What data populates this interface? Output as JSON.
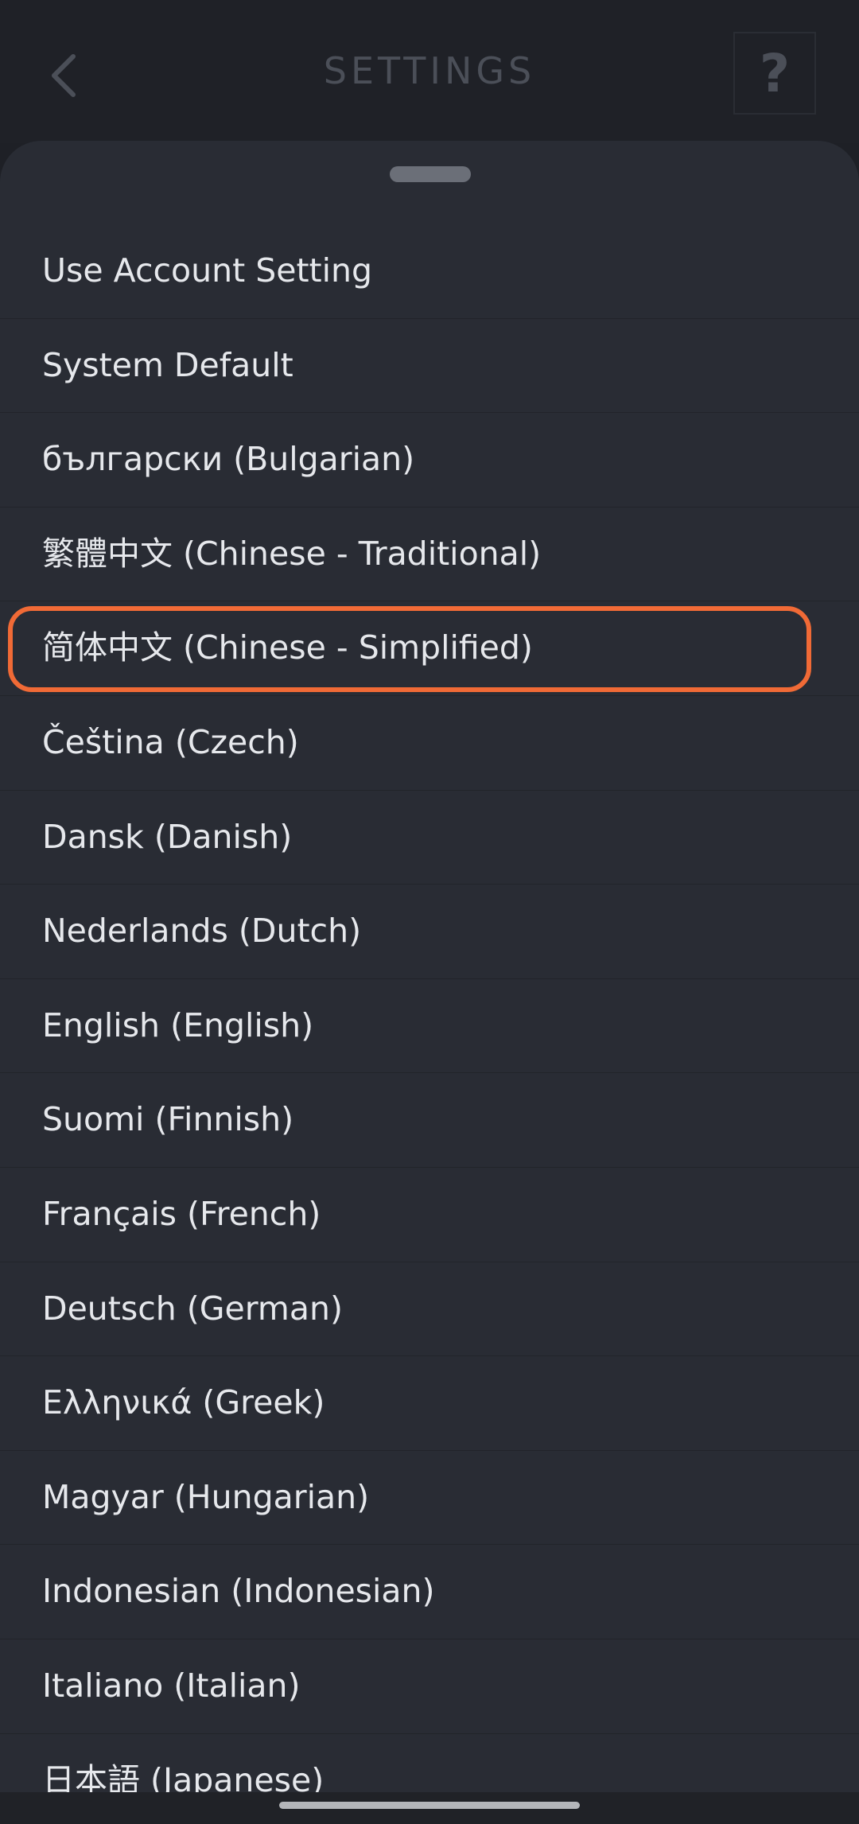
{
  "header": {
    "title": "SETTINGS",
    "help_label": "?"
  },
  "languages": [
    "Use Account Setting",
    "System Default",
    "български (Bulgarian)",
    "繁體中文 (Chinese - Traditional)",
    "简体中文 (Chinese - Simplified)",
    "Čeština (Czech)",
    "Dansk (Danish)",
    "Nederlands (Dutch)",
    "English (English)",
    "Suomi (Finnish)",
    "Français (French)",
    "Deutsch (German)",
    "Ελληνικά (Greek)",
    "Magyar (Hungarian)",
    "Indonesian (Indonesian)",
    "Italiano (Italian)",
    "日本語 (Japanese)"
  ],
  "highlighted_language": "简体中文 (Chinese - Simplified)",
  "colors": {
    "highlight": "#f06a36",
    "sheet_background": "#292c34",
    "text": "#e6e8ec"
  },
  "icons": {
    "back": "chevron-left-icon",
    "help": "question-mark-icon"
  }
}
